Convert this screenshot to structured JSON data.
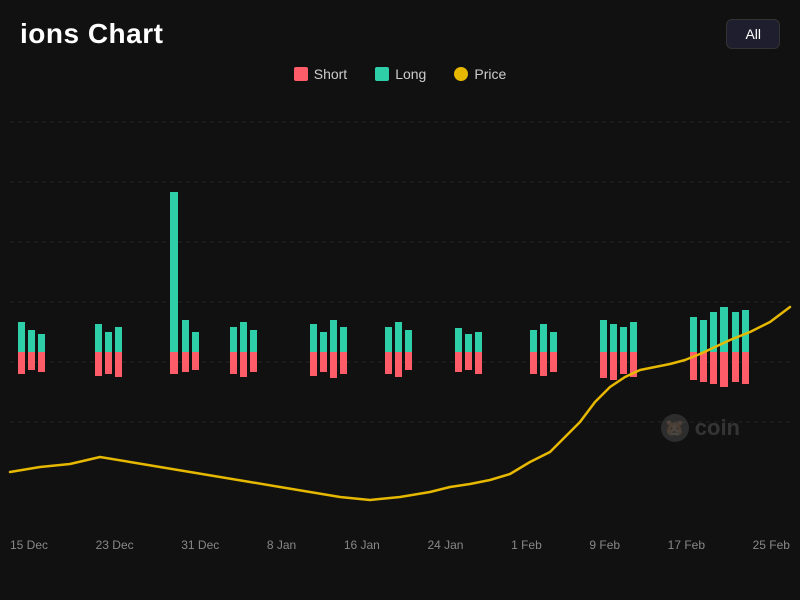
{
  "header": {
    "title": "ions Chart",
    "all_button": "All"
  },
  "legend": [
    {
      "label": "Short",
      "color": "#ff5c6a"
    },
    {
      "label": "Long",
      "color": "#2ecfa8"
    },
    {
      "label": "Price",
      "color": "#e6b800"
    }
  ],
  "x_axis_labels": [
    "15 Dec",
    "23 Dec",
    "31 Dec",
    "8 Jan",
    "16 Jan",
    "24 Jan",
    "1 Feb",
    "9 Feb",
    "17 Feb",
    "25 Feb"
  ],
  "watermark": "coin",
  "chart": {
    "short_color": "#ff5c6a",
    "long_color": "#2ecfa8",
    "price_color": "#e6b800",
    "grid_color": "rgba(255,255,255,0.08)"
  }
}
